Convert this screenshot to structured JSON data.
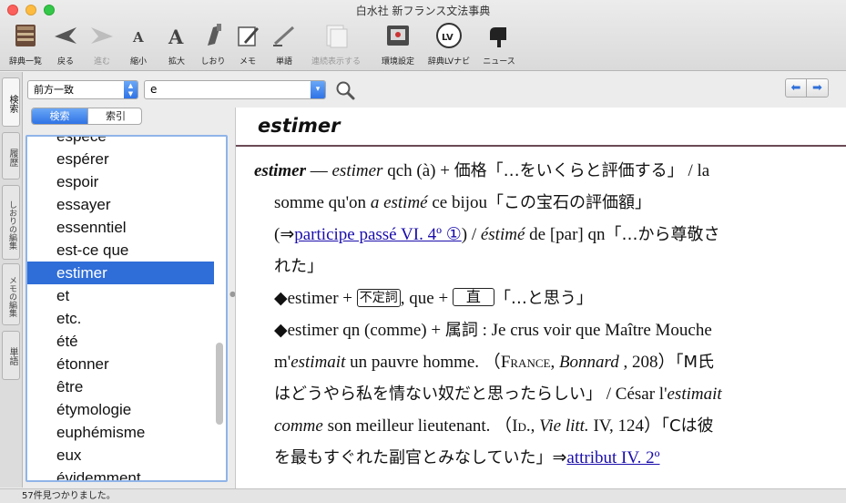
{
  "window": {
    "title": "白水社 新フランス文法事典"
  },
  "toolbar": [
    {
      "label": "辞典一覧",
      "icon": "book-stack-icon",
      "enabled": true
    },
    {
      "label": "戻る",
      "icon": "back-arrow-icon",
      "enabled": true
    },
    {
      "label": "進む",
      "icon": "forward-arrow-icon",
      "enabled": false
    },
    {
      "label": "縮小",
      "icon": "text-smaller-icon",
      "enabled": true
    },
    {
      "label": "拡大",
      "icon": "text-larger-icon",
      "enabled": true
    },
    {
      "label": "しおり",
      "icon": "bookmark-icon",
      "enabled": true
    },
    {
      "label": "メモ",
      "icon": "memo-pencil-icon",
      "enabled": true
    },
    {
      "label": "単語",
      "icon": "word-pen-icon",
      "enabled": true
    },
    {
      "label": "連続表示する",
      "icon": "continuous-display-icon",
      "enabled": false
    },
    {
      "label": "環境設定",
      "icon": "preferences-icon",
      "enabled": true
    },
    {
      "label": "辞典LVナビ",
      "icon": "lv-navi-icon",
      "enabled": true
    },
    {
      "label": "ニュース",
      "icon": "mailbox-icon",
      "enabled": true
    }
  ],
  "side_tabs": [
    {
      "label": "検索",
      "active": true
    },
    {
      "label": "履歴",
      "active": false
    },
    {
      "label": "しおりの編集",
      "active": false
    },
    {
      "label": "メモの編集",
      "active": false
    },
    {
      "label": "単語",
      "active": false
    }
  ],
  "search": {
    "mode": "前方一致",
    "query": "e",
    "segments": [
      "検索",
      "索引"
    ],
    "selected_segment": "検索"
  },
  "word_list": {
    "items": [
      "espèce",
      "espérer",
      "espoir",
      "essayer",
      "essenntiel",
      "est-ce que",
      "estimer",
      "et",
      "etc.",
      "été",
      "étonner",
      "être",
      "étymologie",
      "euphémisme",
      "eux",
      "évidemment"
    ],
    "selected": "estimer"
  },
  "entry": {
    "headword": "estimer",
    "lines": {
      "l1_hw": "estimer",
      "l1_dash": " — ",
      "l1_i1": "estimer",
      "l1_t1": " qch (à) + ",
      "l1_jp": "価格「…をいくらと評価する」",
      "l1_t2": " / la",
      "l2_t1": "somme qu'on ",
      "l2_i1": "a estimé",
      "l2_t2": " ce bijou",
      "l2_jp": "「この宝石の評価額」",
      "l3_t1": "(⇒",
      "l3_link": "participe passé VI. 4º ①",
      "l3_t2": ") / ",
      "l3_i1": "éstimé",
      "l3_t3": " de [par] qn",
      "l3_jp": "「…から尊敬さ",
      "l4_jp": "れた」",
      "l5_t1": "◆estimer + ",
      "l5_box1": "不定詞",
      "l5_t2": ",   que + ",
      "l5_box2": "直",
      "l5_jp": "「…と思う」",
      "l6_t1": "◆estimer qn (comme) + ",
      "l6_jp": "属詞",
      "l6_t2": " : Je crus voir que Maître Mouche",
      "l7_t1": "m'",
      "l7_i1": "estimait",
      "l7_t2": " un pauvre homme. （",
      "l7_sc": "France",
      "l7_t3": ", ",
      "l7_i2": "Bonnard",
      "l7_t4": " , 208）",
      "l7_jp": "「M氏",
      "l8_jp": "はどうやら私を情ない奴だと思ったらしい」",
      "l8_t1": " / César l'",
      "l8_i1": "estimait",
      "l9_i1": "comme",
      "l9_t1": " son meilleur lieutenant. （",
      "l9_sc": "Id.",
      "l9_t2": ", ",
      "l9_i2": "Vie litt.",
      "l9_t3": " IV, 124）",
      "l9_jp": "「Cは彼",
      "l10_jp": "を最もすぐれた副官とみなしていた」",
      "l10_t1": "⇒",
      "l10_link": "attribut IV. 2º"
    }
  },
  "status": {
    "text": "57件見つかりました。"
  },
  "colors": {
    "selection": "#2f6dd8",
    "link": "#1a0dab",
    "headword_rule": "#6b4a55"
  }
}
